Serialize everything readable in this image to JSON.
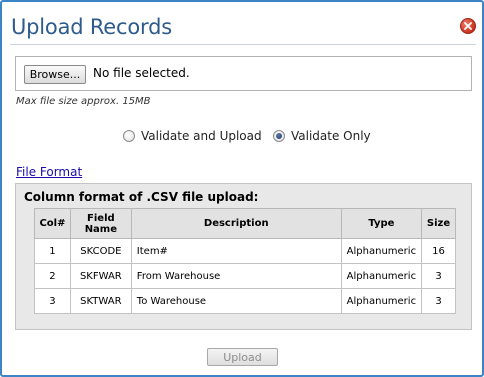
{
  "dialog": {
    "title": "Upload Records",
    "close_icon": "close-icon"
  },
  "file_input": {
    "browse_label": "Browse...",
    "status": "No file selected."
  },
  "max_size_note": "Max file size approx. 15MB",
  "mode": {
    "options": [
      {
        "label": "Validate and Upload",
        "checked": false
      },
      {
        "label": "Validate Only",
        "checked": true
      }
    ]
  },
  "file_format_link": "File Format",
  "format_panel": {
    "title": "Column format of .CSV file upload:",
    "headers": {
      "col": "Col#",
      "field": "Field\nName",
      "description": "Description",
      "type": "Type",
      "size": "Size"
    },
    "rows": [
      {
        "col": "1",
        "field": "SKCODE",
        "description": "Item#",
        "type": "Alphanumeric",
        "size": "16"
      },
      {
        "col": "2",
        "field": "SKFWAR",
        "description": "From Warehouse",
        "type": "Alphanumeric",
        "size": "3"
      },
      {
        "col": "3",
        "field": "SKTWAR",
        "description": "To Warehouse",
        "type": "Alphanumeric",
        "size": "3"
      }
    ]
  },
  "upload_button": {
    "label": "Upload",
    "enabled": false
  },
  "colors": {
    "title": "#2f5b8c",
    "border": "#3d84c7",
    "link": "#1a0dab"
  }
}
